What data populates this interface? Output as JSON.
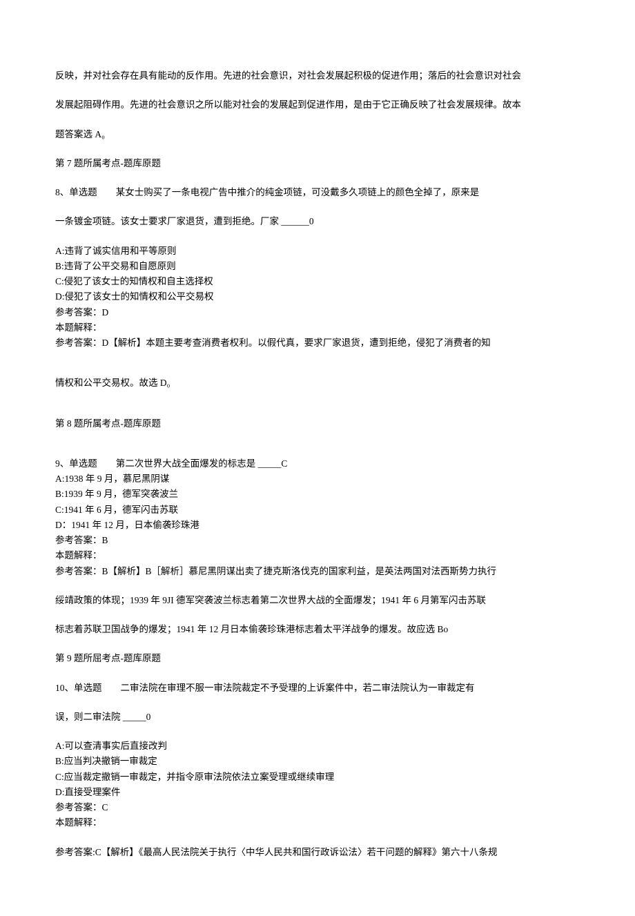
{
  "intro": {
    "line1": "反映，并对社会存在具有能动的反作用。先进的社会意识，对社会发展起积极的促进作用；落后的社会意识对社会",
    "line2": "发展起阻碍作用。先进的社会意识之所以能对社会的发展起到促进作用，是由于它正确反映了社会发展规律。故本",
    "line3": "题答案选 A₀"
  },
  "q7": {
    "topic": "第 7 题所属考点-题库原题"
  },
  "q8": {
    "stem_a": "8、单选题　　某女士购买了一条电视广告中推介的纯金项链，可没戴多久项链上的颜色全掉了，原来是",
    "stem_b": "一条镀金项链。该女士要求厂家退货，遭到拒绝。厂家 ______0",
    "optA": "A:违背了诚实信用和平等原则",
    "optB": "B:违背了公平交易和自愿原则",
    "optC": "C:侵犯了该女士的知情权和自主选择权",
    "optD": "D:侵犯了该女士的知情权和公平交易权",
    "ans": "参考答案：D",
    "exp_label": "本题解释：",
    "exp1": "参考答案：D【解析】本题主要考查消费者权利。以假代真，要求厂家退货，遭到拒绝，侵犯了消费者的知",
    "exp2": "情权和公平交易权。故选 D₀",
    "topic": "第 8 题所属考点-题库原题"
  },
  "q9": {
    "stem": "9、单选题　　第二次世界大战全面爆发的标志是 _____C",
    "optA": "A:1938 年 9 月，慕尼黑阴谋",
    "optB": "B:1939 年 9 月，德军突袭波兰",
    "optC": "C:1941 年 6 月，德军闪击苏联",
    "optD": "D：1941 年 12 月，日本偷袭珍珠港",
    "ans": "参考答案：B",
    "exp_label": "本题解释：",
    "exp1": "参考答案：B【解析】B［解析］慕尼黑阴谋出卖了捷克斯洛伐克的国家利益，是英法两国对法西斯势力执行",
    "exp2": "绥靖政策的体现；1939 年 9JI 德军突袭波兰标志着第二次世界大战的全面爆发；1941 年 6 月第军闪击苏联",
    "exp3": "标志着苏联卫国战争的爆发；1941 年 12 月日本偷袭珍珠港标志着太平洋战争的爆发。故应选 Bo",
    "topic": "第 9 题所屈考点-题库原题"
  },
  "q10": {
    "stem_a": "10、单选题　　二审法院在审理不服一审法院裁定不予受理的上诉案件中，若二审法院认为一审裁定有",
    "stem_b": "误，则二审法院 _____0",
    "optA": "A:可以查清事实后直接改判",
    "optB": "B:应当判决撤销一审裁定",
    "optC": "C:应当裁定撤销一审裁定，并指令原审法院依法立案受理或继续审理",
    "optD": "D:直接受理案件",
    "ans": "参考答案：C",
    "exp_label": "本题解释：",
    "exp1": "参考答案:C【解析】《最高人民法院关于执行〈中华人民共和国行政诉讼法〉若干问题的解释》第六十八条规"
  }
}
